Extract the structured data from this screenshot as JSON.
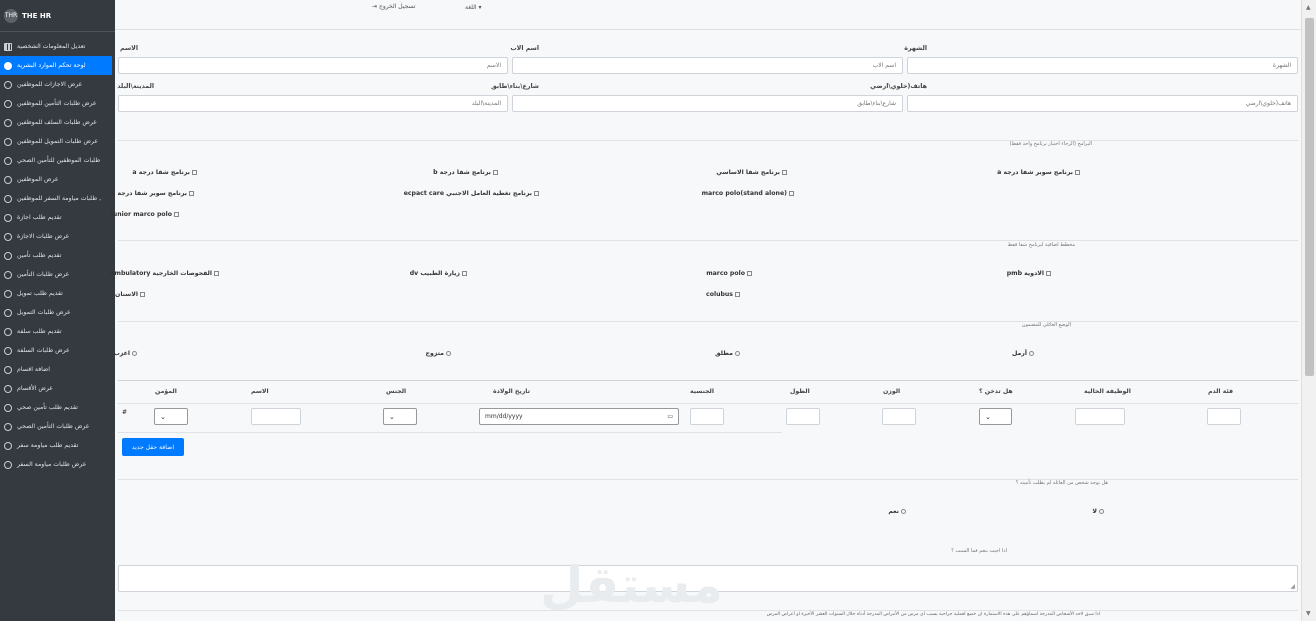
{
  "sidebar": {
    "brand_logo": "THR",
    "brand": "THE HR",
    "items": [
      {
        "label": "تعديل المعلومات الشخصية",
        "icon": "grid-icon",
        "active": false
      },
      {
        "label": "لوحة تحكم الموارد البشرية",
        "icon": "dashboard-icon",
        "active": true
      },
      {
        "label": "عرض الاجازات للموظفين",
        "icon": "circle-icon",
        "active": false
      },
      {
        "label": "عرض طلبات التأمين للموظفين",
        "icon": "circle-icon",
        "active": false
      },
      {
        "label": "عرض طلبات السلف للموظفين",
        "icon": "circle-icon",
        "active": false
      },
      {
        "label": "عرض طلبات التمويل للموظفين",
        "icon": "circle-icon",
        "active": false
      },
      {
        "label": "طلبات الموظفين للتأمين الصحي",
        "icon": "circle-icon",
        "active": false
      },
      {
        "label": "عرض الموظفين",
        "icon": "circle-icon",
        "active": false
      },
      {
        "label": "طلبات مياومة السفر للموظفين ,",
        "icon": "circle-icon",
        "active": false
      },
      {
        "label": "تقديم طلب اجازة",
        "icon": "circle-icon",
        "active": false
      },
      {
        "label": "عرض طلبات الاجازة",
        "icon": "circle-icon",
        "active": false
      },
      {
        "label": "تقديم طلب تأمين",
        "icon": "circle-icon",
        "active": false
      },
      {
        "label": "عرض طلبات التأمين",
        "icon": "circle-icon",
        "active": false
      },
      {
        "label": "تقديم طلب تمويل",
        "icon": "circle-icon",
        "active": false
      },
      {
        "label": "عرض طلبات التمويل",
        "icon": "circle-icon",
        "active": false
      },
      {
        "label": "تقديم طلب سلفة",
        "icon": "circle-icon",
        "active": false
      },
      {
        "label": "عرض طلبات السلفة",
        "icon": "circle-icon",
        "active": false
      },
      {
        "label": "اضافة اقسام",
        "icon": "circle-icon",
        "active": false
      },
      {
        "label": "عرض الأقسام",
        "icon": "circle-icon",
        "active": false
      },
      {
        "label": "تقديم طلب تأمين صحي",
        "icon": "circle-icon",
        "active": false
      },
      {
        "label": "عرض طلبات التأمين الصحي",
        "icon": "circle-icon",
        "active": false
      },
      {
        "label": "تقديم طلب مياومة سفر",
        "icon": "circle-icon",
        "active": false
      },
      {
        "label": "عرض طلبات مياومة السفر",
        "icon": "circle-icon",
        "active": false
      }
    ]
  },
  "topbar": {
    "logout": "تسجيل الخروج",
    "language": "اللغة ▾"
  },
  "personal": {
    "last_name_label": "الشهرة",
    "last_name_placeholder": "الشهرة",
    "father_label": "اسم الاب",
    "father_placeholder": "اسم الاب",
    "name_label": "الاسم",
    "name_placeholder": "الاسم",
    "phone_label": "هاتف(خلوي\\ارضي",
    "phone_placeholder": "هاتف(خلوي\\ارضي",
    "street_label": "شارع\\بناء\\طابق",
    "street_placeholder": "شارع\\بناء\\طابق",
    "city_label": "المدينة\\البلد",
    "city_placeholder": "المدينة\\البلد"
  },
  "programs": {
    "title": "البرامج (الرجاء اختيار برنامج واحد فقط)",
    "options": [
      "برنامج سوبر شفا درجة a",
      "برنامج شفا الاساسي",
      "برنامج شفا درجة b",
      "برنامج شفا درجة a",
      "marco polo(stand alone)",
      "برنامج تغطية العامل الاجنبي ecpact care",
      "برنامج سوبر شفا درجة b",
      "junior marco polo"
    ]
  },
  "extras": {
    "title": "مخطط اضافية لبرنامج شفا فقط",
    "options": [
      "الادوية pmb",
      "marco polo",
      "زيارة الطبيب dv",
      "الفحوصات الخارجية ambulatory",
      "colubus",
      "الاسنان"
    ]
  },
  "family": {
    "title": "الوضع العائلي للمضمون",
    "options": [
      "أرمل",
      "مطلق",
      "متزوج",
      "اعزب"
    ]
  },
  "table": {
    "headers": {
      "blood": "فئة الدم",
      "job": "الوظيفة الحالية",
      "smoker": "هل تدخن ؟",
      "weight": "الوزن",
      "height": "الطول",
      "nationality": "الجنسية",
      "birth": "تاريخ الولادة",
      "gender": "الجنس",
      "name": "الاسم",
      "insured": "المؤمن"
    },
    "date_placeholder": "mm/dd/yyyy",
    "row_marker": "#"
  },
  "add_button": "اضافة حقل جديد",
  "question1": {
    "text": "هل يوجد شخص من العائلة لم يطلب تأمينه ؟",
    "yes": "نعم",
    "no": "لا"
  },
  "question2": "اذا اجبت بنعم فما السبب ؟",
  "watermark": "مستقل",
  "footer_note": "اذا سبق لاحد الأشخاص المدرجة اسماؤهم على هذه الاستمارة ان خضع لعملية جراحية بسبب اي مرض من الأمراض المدرجة أدناه خلال السنوات العشر الأخيرة او اعراض المرض"
}
